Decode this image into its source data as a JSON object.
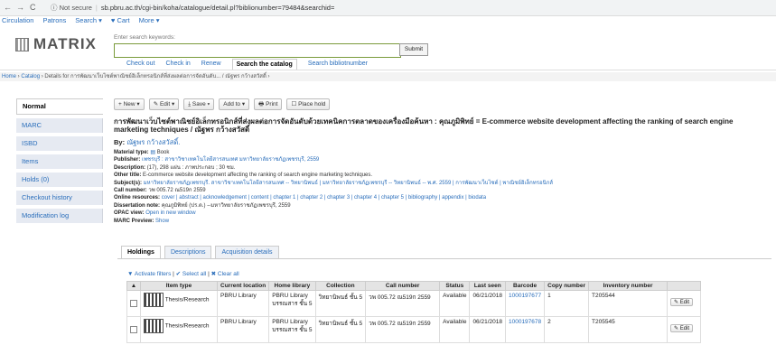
{
  "browser": {
    "back": "←",
    "forward": "→",
    "reload": "C",
    "security": "Not secure",
    "url": "sb.pbru.ac.th/cgi-bin/koha/catalogue/detail.pl?biblionumber=79484&searchid="
  },
  "topmenu": [
    "Circulation",
    "Patrons",
    "Search ▾",
    "♥ Cart",
    "More ▾"
  ],
  "logo": "MATRIX",
  "search": {
    "label": "Enter search keywords:",
    "value": "",
    "submit": "Submit",
    "tabs": [
      "Check out",
      "Check in",
      "Renew",
      "Search the catalog",
      "Search bibliotnumber"
    ],
    "active_tab": "Search the catalog"
  },
  "breadcrumb": {
    "home": "Home",
    "catalog": "Catalog",
    "details": "› Details for การพัฒนาเว็บไซต์พาณิชย์อิเล็กทรอนิกส์ที่ส่งผลต่อการจัดอันดับ... / ณัฐพร กว้างสวัสดิ์ ›"
  },
  "leftnav": [
    "Normal",
    "MARC",
    "ISBD",
    "Items",
    "Holds (0)",
    "Checkout history",
    "Modification log"
  ],
  "toolbar": [
    "+ New ▾",
    "✎ Edit ▾",
    "⤓ Save ▾",
    "Add to ▾",
    "🖶 Print",
    "☐ Place hold"
  ],
  "record": {
    "title": "การพัฒนาเว็บไซต์พาณิชย์อิเล็กทรอนิกส์ที่ส่งผลต่อการจัดอันดับด้วยเทคนิคการตลาดของเครื่องมือค้นหา : คุณภูมิพิทย์ = E-commerce website development affecting the ranking of search engine marketing techniques / ณัฐพร กว้างสวัสดิ์",
    "by_label": "By:",
    "author": "ณัฐพร กว้างสวัสดิ์.",
    "material_label": "Material type:",
    "material": "Book",
    "publisher_label": "Publisher:",
    "publisher": "เพชรบุรี : สาขาวิชาเทคโนโลยีสารสนเทศ มหาวิทยาลัยราชภัฏเพชรบุรี, 2559",
    "description_label": "Description:",
    "description": "(17), 298 แผ่น : ภาพประกอบ ; 30 ซม.",
    "othertitle_label": "Other title:",
    "othertitle": "E-commerce website development affecting the ranking of search engine marketing techniques.",
    "subjects_label": "Subject(s):",
    "subjects": "มหาวิทยาลัยราชภัฏเพชรบุรี. สาขาวิชาเทคโนโลยีสารสนเทศ -- วิทยานิพนธ์ | มหาวิทยาลัยราชภัฏเพชรบุรี -- วิทยานิพนธ์ -- พ.ศ. 2559 | การพัฒนาเว็บไซต์ | พาณิชย์อิเล็กทรอนิกส์",
    "callnumber_label": "Call number:",
    "callnumber": "วพ 005.72 ณ519ก 2559",
    "online_label": "Online resources:",
    "online": "cover | abstract | acknowledgement | content | chapter 1 | chapter 2 | chapter 3 | chapter 4 | chapter 5 | bibliography | appendix | biodata",
    "dissertation_label": "Dissertation note:",
    "dissertation": "คุณภูมิพิทย์ (ปร.ด.) --มหาวิทยาลัยราชภัฏเพชรบุรี, 2559",
    "opac_label": "OPAC view:",
    "opac": "Open in new window",
    "marc_label": "MARC Preview:",
    "marc": "Show"
  },
  "holdings_tabs": [
    "Holdings",
    "Descriptions",
    "Acquisition details"
  ],
  "filters": {
    "activate": "▼ Activate filters",
    "select_all": "✔ Select all",
    "clear_all": "✖ Clear all"
  },
  "holdings": {
    "headers": [
      "▲",
      "Item type",
      "Current location",
      "Home library",
      "Collection",
      "Call number",
      "Status",
      "Last seen",
      "Barcode",
      "Copy number",
      "Inventory number",
      ""
    ],
    "rows": [
      {
        "type": "Thesis/Research",
        "current": "PBRU Library",
        "home": "PBRU Library",
        "home_sub": "บรรณสาร ชั้น 5",
        "collection": "วิทยานิพนธ์ ชั้น 5",
        "call": "วพ 005.72 ณ519ก 2559",
        "status": "Available",
        "seen": "06/21/2018",
        "barcode": "1000197677",
        "copy": "1",
        "inventory": "T205544",
        "edit": "✎ Edit"
      },
      {
        "type": "Thesis/Research",
        "current": "PBRU Library",
        "home": "PBRU Library",
        "home_sub": "บรรณสาร ชั้น 5",
        "collection": "วิทยานิพนธ์ ชั้น 5",
        "call": "วพ 005.72 ณ519ก 2559",
        "status": "Available",
        "seen": "06/21/2018",
        "barcode": "1000197678",
        "copy": "2",
        "inventory": "T205545",
        "edit": "✎ Edit"
      }
    ]
  }
}
